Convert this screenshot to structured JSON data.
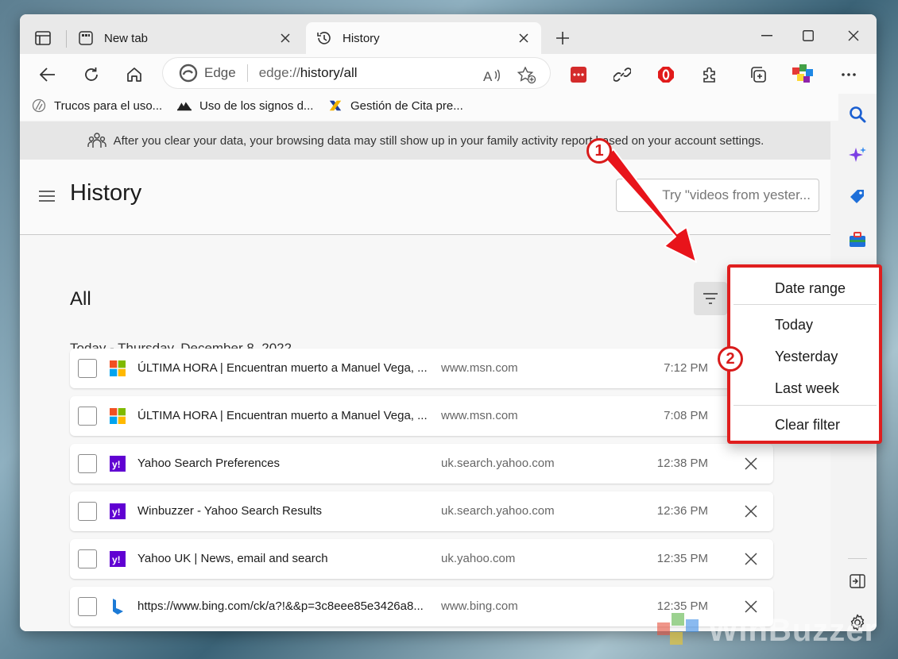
{
  "tabs": [
    {
      "label": "New tab"
    },
    {
      "label": "History"
    }
  ],
  "address": {
    "browser_label": "Edge",
    "url_scheme": "edge://",
    "url_path": "history/all"
  },
  "favorites": [
    {
      "label": "Trucos para el uso..."
    },
    {
      "label": "Uso de los signos d..."
    },
    {
      "label": "Gestión de Cita pre..."
    }
  ],
  "banner": {
    "text": "After you clear your data, your browsing data may still show up in your family activity report based on your account settings."
  },
  "history": {
    "title": "History",
    "search_placeholder": "Try \"videos from yester...",
    "section": "All",
    "date_header": "Today - Thursday, December 8, 2022",
    "items": [
      {
        "title": "ÚLTIMA HORA | Encuentran muerto a Manuel Vega, ...",
        "domain": "www.msn.com",
        "time": "7:12 PM",
        "icon": "microsoft-icon"
      },
      {
        "title": "ÚLTIMA HORA | Encuentran muerto a Manuel Vega, ...",
        "domain": "www.msn.com",
        "time": "7:08 PM",
        "icon": "microsoft-icon"
      },
      {
        "title": "Yahoo Search Preferences",
        "domain": "uk.search.yahoo.com",
        "time": "12:38 PM",
        "icon": "yahoo-icon"
      },
      {
        "title": "Winbuzzer - Yahoo Search Results",
        "domain": "uk.search.yahoo.com",
        "time": "12:36 PM",
        "icon": "yahoo-icon"
      },
      {
        "title": "Yahoo UK | News, email and search",
        "domain": "uk.yahoo.com",
        "time": "12:35 PM",
        "icon": "yahoo-icon"
      },
      {
        "title": "https://www.bing.com/ck/a?!&&p=3c8eee85e3426a8...",
        "domain": "www.bing.com",
        "time": "12:35 PM",
        "icon": "bing-icon"
      }
    ]
  },
  "filter_menu": {
    "items": [
      "Date range",
      "Today",
      "Yesterday",
      "Last week",
      "Clear filter"
    ]
  },
  "callouts": [
    "1",
    "2"
  ],
  "watermark": "WinBuzzer",
  "colors": {
    "annotation_red": "#e01e1e",
    "yahoo_purple": "#6001d2",
    "bing_blue": "#1c7ad6"
  }
}
